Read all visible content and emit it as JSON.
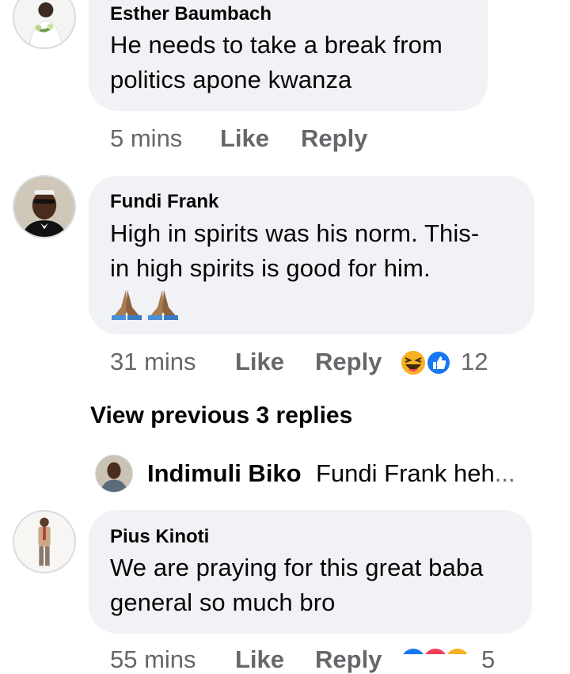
{
  "comments": [
    {
      "author": "Esther Baumbach",
      "lines": [
        "He needs to take a break from",
        "politics apone kwanza"
      ],
      "time": "5 mins",
      "like_label": "Like",
      "reply_label": "Reply"
    },
    {
      "author": "Fundi Frank",
      "lines": [
        "High in spirits was his norm. This-",
        "in high spirits is good for him."
      ],
      "emoji": [
        "folded-hands",
        "folded-hands"
      ],
      "time": "31 mins",
      "like_label": "Like",
      "reply_label": "Reply",
      "reactions": [
        "haha",
        "like"
      ],
      "reaction_count": "12"
    },
    {
      "author": "Pius Kinoti",
      "lines": [
        "We are praying for this great baba",
        "general so much bro"
      ],
      "time": "55 mins",
      "like_label": "Like",
      "reply_label": "Reply",
      "reactions": [
        "like",
        "love",
        "haha"
      ],
      "reaction_count": "5"
    }
  ],
  "replies_thread": {
    "view_previous_label": "View previous 3 replies",
    "latest_reply": {
      "author": "Indimuli Biko",
      "snippet": "Fundi Frank heh",
      "ellipsis": "..."
    }
  },
  "colors": {
    "bubble": "#f0f2f5",
    "meta_text": "#65676b",
    "like_blue": "#1877f2",
    "love_red": "#f33e58",
    "haha_yellow": "#f7b125"
  }
}
